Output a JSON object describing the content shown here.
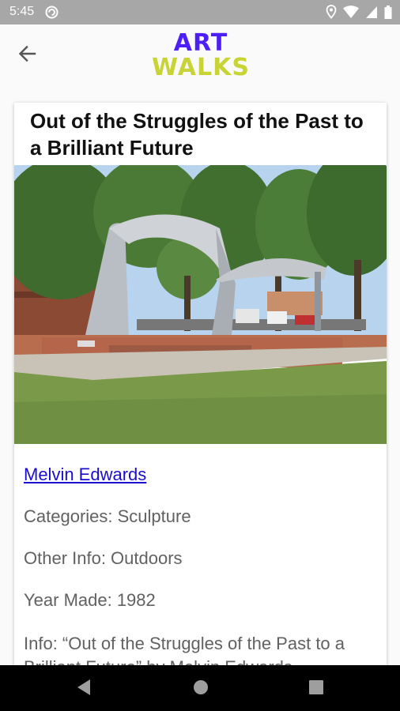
{
  "status_bar": {
    "time": "5:45"
  },
  "app_bar": {
    "logo_line1": "ART",
    "logo_line2": "WALKS"
  },
  "card": {
    "title": "Out of the Struggles of the Past to a Brilliant Future",
    "artist": "Melvin Edwards",
    "categories": "Categories: Sculpture",
    "other_info": "Other Info: Outdoors",
    "year": "Year Made: 1982",
    "info": "Info: “Out of the Struggles of the Past to a Brilliant Future” by Melvin Edwards"
  },
  "colors": {
    "logo_purple": "#4b1ff5",
    "logo_yellow": "#c8d436",
    "link": "#1a0dcc"
  }
}
